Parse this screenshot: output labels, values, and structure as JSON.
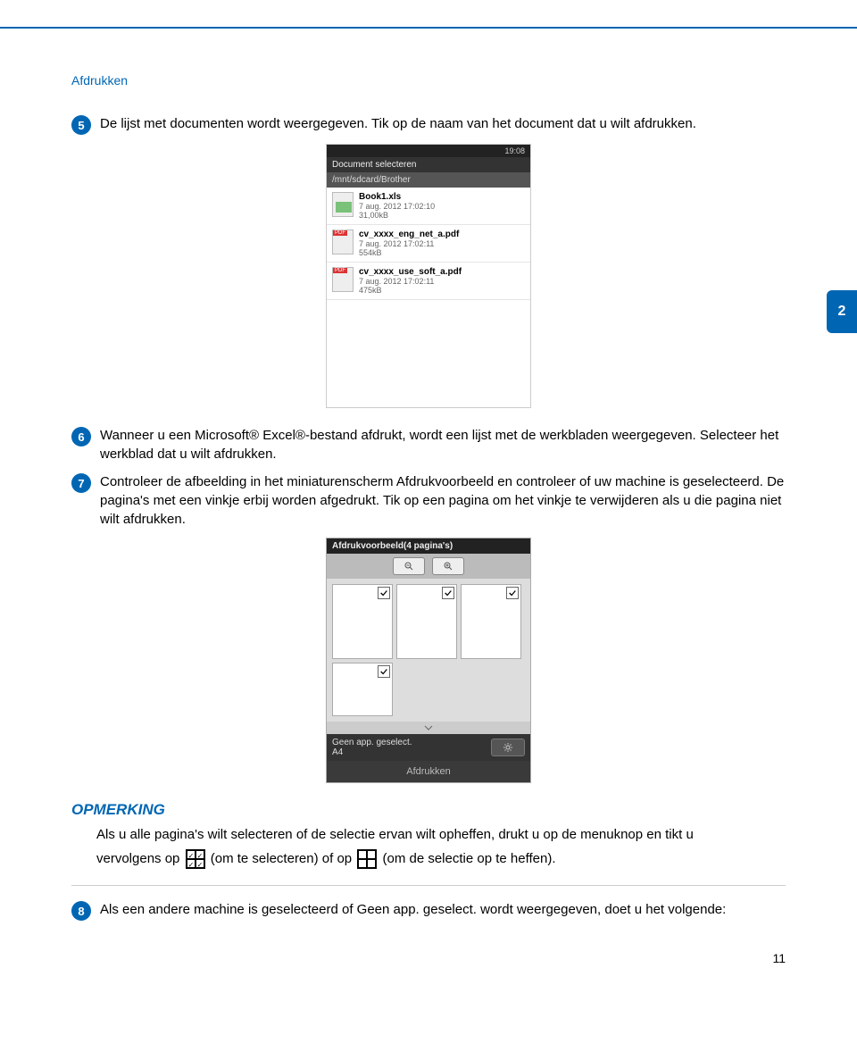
{
  "header": {
    "section": "Afdrukken"
  },
  "side_tab": "2",
  "steps": {
    "s5": "De lijst met documenten wordt weergegeven. Tik op de naam van het document dat u wilt afdrukken.",
    "s6": "Wanneer u een Microsoft® Excel®-bestand afdrukt, wordt een lijst met de werkbladen weergegeven. Selecteer het werkblad dat u wilt afdrukken.",
    "s7": "Controleer de afbeelding in het miniaturenscherm Afdrukvoorbeeld en controleer of uw machine is geselecteerd. De pagina's met een vinkje erbij worden afgedrukt. Tik op een pagina om het vinkje te verwijderen als u die pagina niet wilt afdrukken.",
    "s8": "Als een andere machine is geselecteerd of Geen app. geselect. wordt weergegeven, doet u het volgende:"
  },
  "shot1": {
    "time": "19:08",
    "title": "Document selecteren",
    "path": "/mnt/sdcard/Brother",
    "files": [
      {
        "name": "Book1.xls",
        "meta": "7 aug. 2012 17:02:10",
        "size": "31,00kB",
        "type": "xls"
      },
      {
        "name": "cv_xxxx_eng_net_a.pdf",
        "meta": "7 aug. 2012 17:02:11",
        "size": "554kB",
        "type": "pdf"
      },
      {
        "name": "cv_xxxx_use_soft_a.pdf",
        "meta": "7 aug. 2012 17:02:11",
        "size": "475kB",
        "type": "pdf"
      }
    ]
  },
  "shot2": {
    "title": "Afdrukvoorbeeld(4 pagina's)",
    "status_line1": "Geen app. geselect.",
    "status_line2": "A4",
    "print_btn": "Afdrukken"
  },
  "note": {
    "title": "OPMERKING",
    "line1a": "Als u alle pagina's wilt selecteren of de selectie ervan wilt opheffen, drukt u op de menuknop en tikt u",
    "line1b": "vervolgens op ",
    "line1c": " (om te selecteren) of op ",
    "line1d": " (om de selectie op te heffen)."
  },
  "page_number": "11"
}
